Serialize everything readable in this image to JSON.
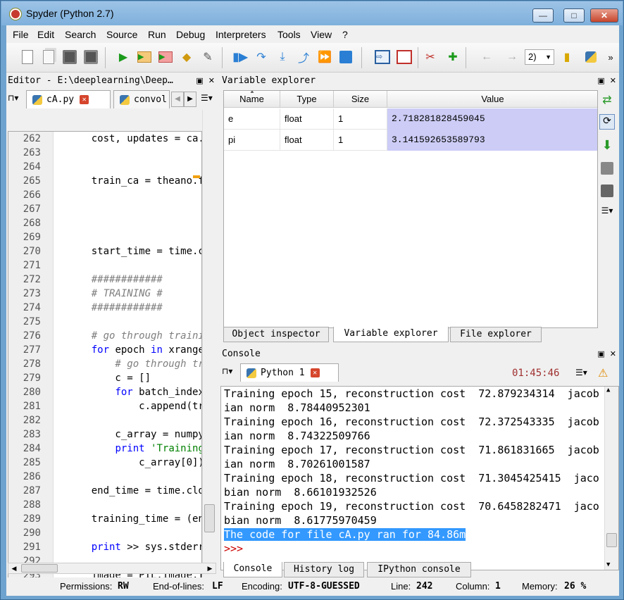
{
  "window": {
    "title": "Spyder (Python 2.7)",
    "min": "—",
    "max": "□",
    "close": "✕"
  },
  "menu": [
    "File",
    "Edit",
    "Search",
    "Source",
    "Run",
    "Debug",
    "Interpreters",
    "Tools",
    "View",
    "?"
  ],
  "toolbar": {
    "combo_value": "2)",
    "overflow": "»"
  },
  "editor": {
    "title": "Editor - E:\\deeplearning\\Deep…",
    "tabs": [
      {
        "label": "cA.py"
      },
      {
        "label": "convol"
      }
    ],
    "lines": [
      {
        "n": "262",
        "t": "    cost, updates = ca.g"
      },
      {
        "n": "263",
        "t": ""
      },
      {
        "n": "264",
        "t": ""
      },
      {
        "n": "265",
        "t": "    train_ca = theano.fu"
      },
      {
        "n": "266",
        "t": ""
      },
      {
        "n": "267",
        "t": ""
      },
      {
        "n": "268",
        "t": ""
      },
      {
        "n": "269",
        "t": ""
      },
      {
        "n": "270",
        "t": "    start_time = time.cl"
      },
      {
        "n": "271",
        "t": ""
      },
      {
        "n": "272",
        "t": "    ############"
      },
      {
        "n": "273",
        "t": "    # TRAINING #"
      },
      {
        "n": "274",
        "t": "    ############"
      },
      {
        "n": "275",
        "t": ""
      },
      {
        "n": "276",
        "t": "    # go through trainir"
      },
      {
        "n": "277",
        "t": "    for epoch in xrange("
      },
      {
        "n": "278",
        "t": "        # go through tro"
      },
      {
        "n": "279",
        "t": "        c = []"
      },
      {
        "n": "280",
        "t": "        for batch_index "
      },
      {
        "n": "281",
        "t": "            c.append(tra"
      },
      {
        "n": "282",
        "t": ""
      },
      {
        "n": "283",
        "t": "        c_array = numpy."
      },
      {
        "n": "284",
        "t": "        print 'Training "
      },
      {
        "n": "285",
        "t": "            c_array[0]),"
      },
      {
        "n": "286",
        "t": ""
      },
      {
        "n": "287",
        "t": "    end_time = time.cloc"
      },
      {
        "n": "288",
        "t": ""
      },
      {
        "n": "289",
        "t": "    training_time = (end"
      },
      {
        "n": "290",
        "t": ""
      },
      {
        "n": "291",
        "t": "    print >> sys.stderr,"
      },
      {
        "n": "292",
        "t": ""
      },
      {
        "n": "293",
        "t": "    image = PIL.Image.fr"
      }
    ]
  },
  "variables": {
    "title": "Variable explorer",
    "headers": [
      "Name",
      "Type",
      "Size",
      "Value"
    ],
    "rows": [
      {
        "name": "e",
        "type": "float",
        "size": "1",
        "value": "2.718281828459045"
      },
      {
        "name": "pi",
        "type": "float",
        "size": "1",
        "value": "3.141592653589793"
      }
    ],
    "tabs": [
      "Object inspector",
      "Variable explorer",
      "File explorer"
    ]
  },
  "console": {
    "title": "Console",
    "tab": "Python 1",
    "time": "01:45:46",
    "lines": [
      "Training epoch 15, reconstruction cost  72.879234314  jacob",
      "ian norm  8.78440952301",
      "Training epoch 16, reconstruction cost  72.372543335  jacob",
      "ian norm  8.74322509766",
      "Training epoch 17, reconstruction cost  71.861831665  jacob",
      "ian norm  8.70261001587",
      "Training epoch 18, reconstruction cost  71.3045425415  jaco",
      "bian norm  8.66101932526",
      "Training epoch 19, reconstruction cost  70.6458282471  jaco",
      "bian norm  8.61775970459"
    ],
    "highlight": "The code for file cA.py ran for 84.86m",
    "prompt": ">>>",
    "tabs": [
      "Console",
      "History log",
      "IPython console"
    ]
  },
  "status": {
    "permissions_label": "Permissions:",
    "permissions": "RW",
    "eol_label": "End-of-lines:",
    "eol": "LF",
    "encoding_label": "Encoding:",
    "encoding": "UTF-8-GUESSED",
    "line_label": "Line:",
    "line": "242",
    "column_label": "Column:",
    "column": "1",
    "memory_label": "Memory:",
    "memory": "26 %"
  }
}
